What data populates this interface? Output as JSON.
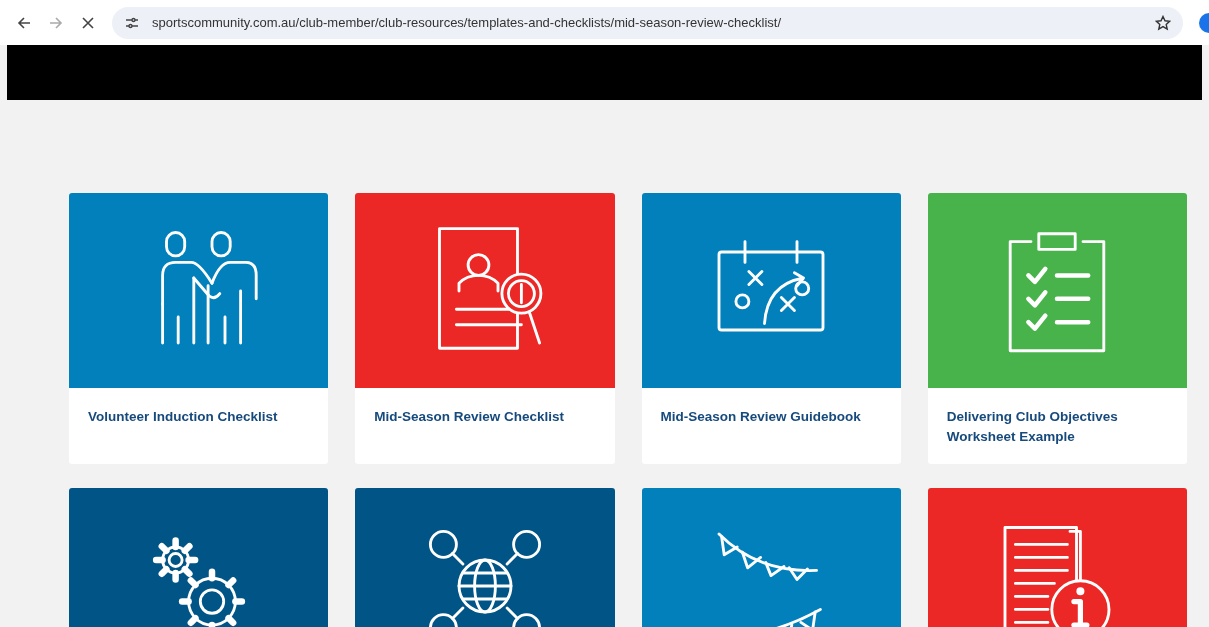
{
  "browser": {
    "url": "sportscommunity.com.au/club-member/club-resources/templates-and-checklists/mid-season-review-checklist/"
  },
  "cards": [
    {
      "title": "Volunteer Induction Checklist",
      "color": "#0180bb",
      "kind": "people"
    },
    {
      "title": "Mid-Season Review Checklist",
      "color": "#ec2827",
      "kind": "review"
    },
    {
      "title": "Mid-Season Review Guidebook",
      "color": "#0180bb",
      "kind": "playbook"
    },
    {
      "title": "Delivering Club Objectives Worksheet Example",
      "color": "#47b34a",
      "kind": "checklist"
    },
    {
      "color": "#015486",
      "kind": "gears"
    },
    {
      "color": "#015486",
      "kind": "network"
    },
    {
      "color": "#0180bb",
      "kind": "bunting"
    },
    {
      "color": "#ec2827",
      "kind": "info"
    }
  ]
}
